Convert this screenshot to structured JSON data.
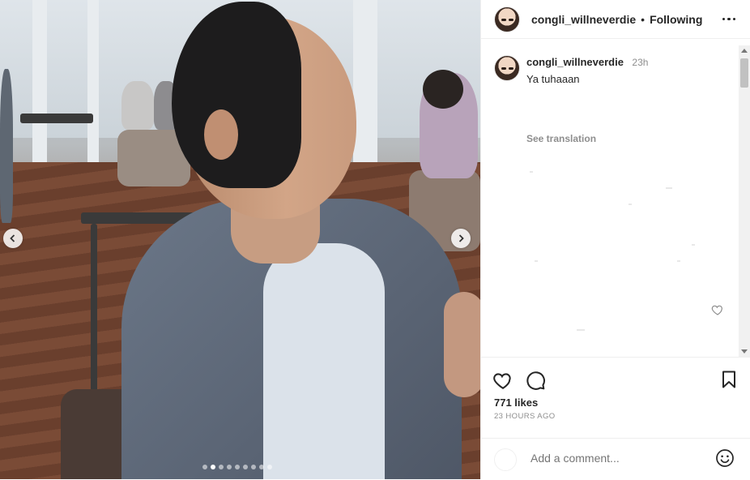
{
  "post": {
    "username": "congli_willneverdie",
    "separator": "•",
    "follow_status": "Following",
    "caption": {
      "username": "congli_willneverdie",
      "time": "23h",
      "text": "Ya tuhaaan",
      "see_translation": "See translation"
    },
    "likes": "771 likes",
    "posted_ago": "23 HOURS AGO",
    "comment_placeholder": "Add a comment...",
    "carousel": {
      "total_slides": 9,
      "active_index": 1
    }
  },
  "icons": {
    "more": "more-options-icon",
    "like": "heart-icon",
    "comment": "comment-icon",
    "save": "bookmark-icon",
    "emoji": "emoji-icon",
    "prev": "chevron-left-icon",
    "next": "chevron-right-icon"
  }
}
